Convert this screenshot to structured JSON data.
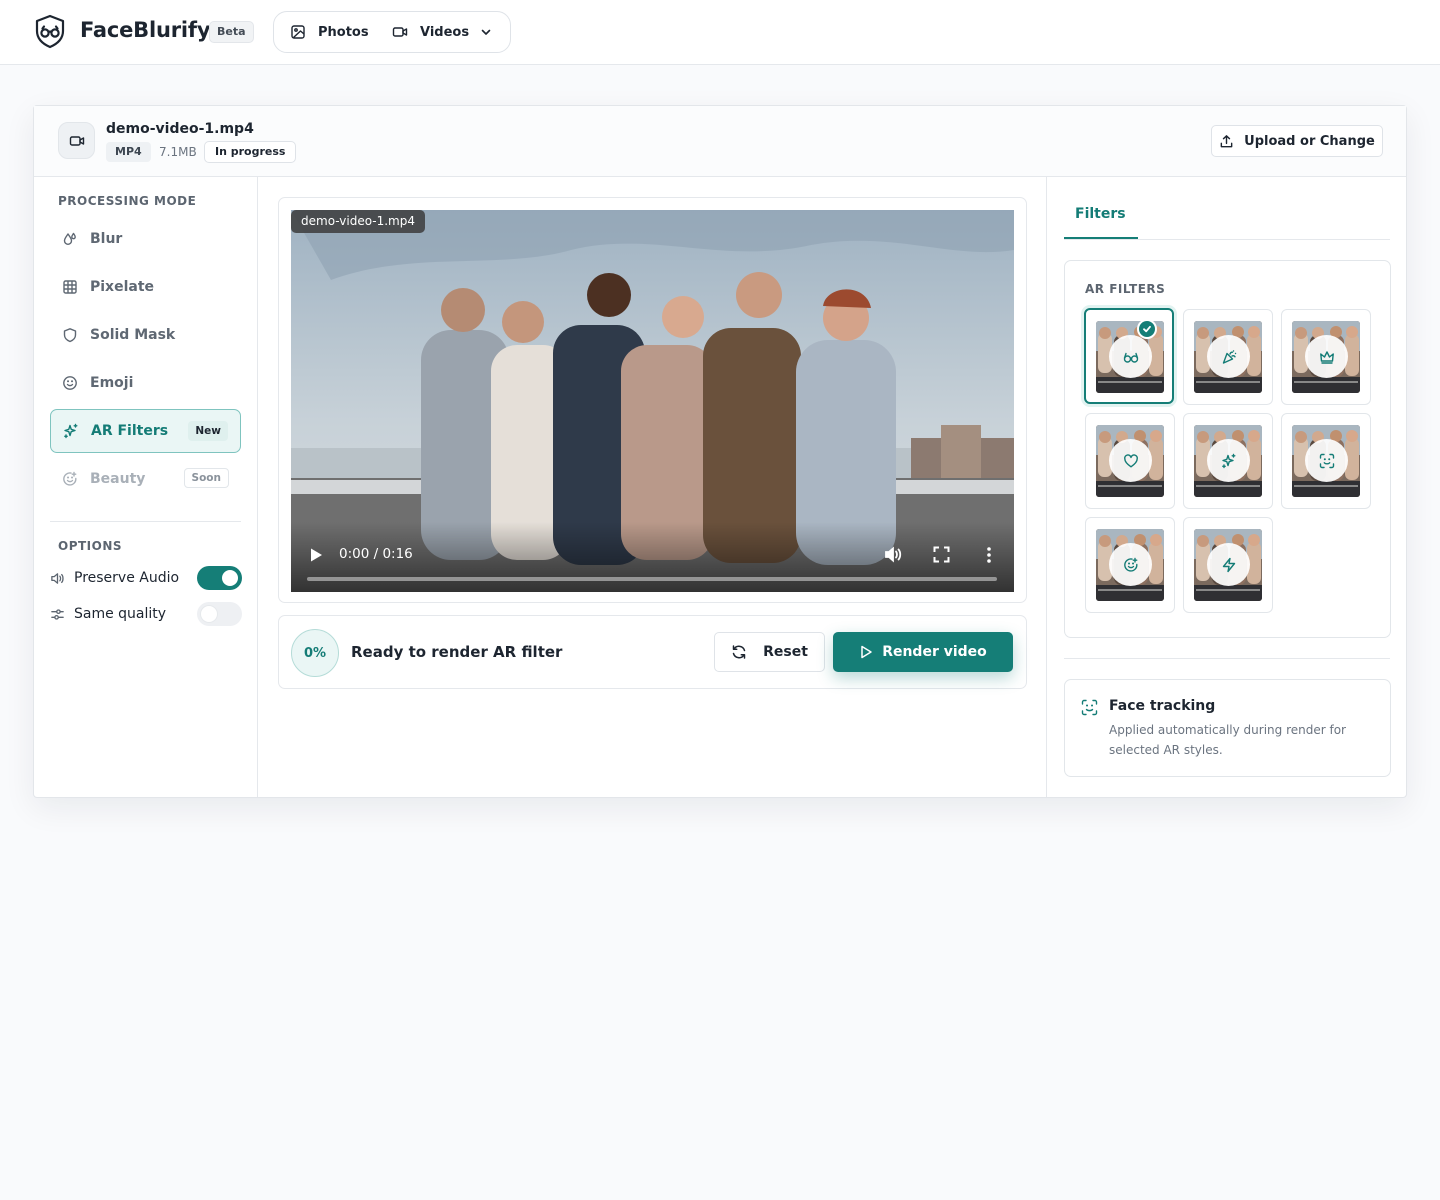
{
  "app": {
    "brand": "FaceBlurify",
    "beta_label": "Beta",
    "nav": {
      "photos_label": "Photos",
      "videos_label": "Videos"
    }
  },
  "file": {
    "name": "demo-video-1.mp4",
    "ext": "MP4",
    "size": "7.1MB",
    "status": "In progress",
    "upload_label": "Upload or Change"
  },
  "sidebar": {
    "processing_title": "PROCESSING MODE",
    "modes": [
      {
        "label": "Blur",
        "icon": "droplets-icon",
        "state": "normal",
        "badge": ""
      },
      {
        "label": "Pixelate",
        "icon": "grid-icon",
        "state": "normal",
        "badge": ""
      },
      {
        "label": "Solid Mask",
        "icon": "shield-icon",
        "state": "normal",
        "badge": ""
      },
      {
        "label": "Emoji",
        "icon": "smile-icon",
        "state": "normal",
        "badge": ""
      },
      {
        "label": "AR Filters",
        "icon": "sparkles-icon",
        "state": "active",
        "badge": "New"
      },
      {
        "label": "Beauty",
        "icon": "smile-plus-icon",
        "state": "disabled",
        "badge": "Soon"
      }
    ],
    "options_title": "OPTIONS",
    "options": [
      {
        "label": "Preserve Audio",
        "icon": "volume-icon",
        "enabled": true
      },
      {
        "label": "Same quality",
        "icon": "sliders-icon",
        "enabled": false
      }
    ]
  },
  "player": {
    "overlay_label": "demo-video-1.mp4",
    "time": "0:00 / 0:16",
    "progress": 0
  },
  "render": {
    "percent": "0%",
    "status": "Ready to render AR filter",
    "reset_label": "Reset",
    "render_label": "Render video"
  },
  "right": {
    "tab_label": "Filters",
    "filters_title": "AR FILTERS",
    "filters": [
      {
        "icon": "glasses-icon",
        "selected": true
      },
      {
        "icon": "party-popper-icon",
        "selected": false
      },
      {
        "icon": "crown-icon",
        "selected": false
      },
      {
        "icon": "heart-icon",
        "selected": false
      },
      {
        "icon": "sparkles-icon",
        "selected": false
      },
      {
        "icon": "scan-face-icon",
        "selected": false
      },
      {
        "icon": "smile-plus-icon",
        "selected": false
      },
      {
        "icon": "zap-icon",
        "selected": false
      }
    ],
    "tracking_title": "Face tracking",
    "tracking_desc": "Applied automatically during render for selected AR styles."
  },
  "colors": {
    "accent": "#157e77",
    "accent_light": "#eaf6f5",
    "text": "#1d2530",
    "muted": "#5c6570"
  }
}
